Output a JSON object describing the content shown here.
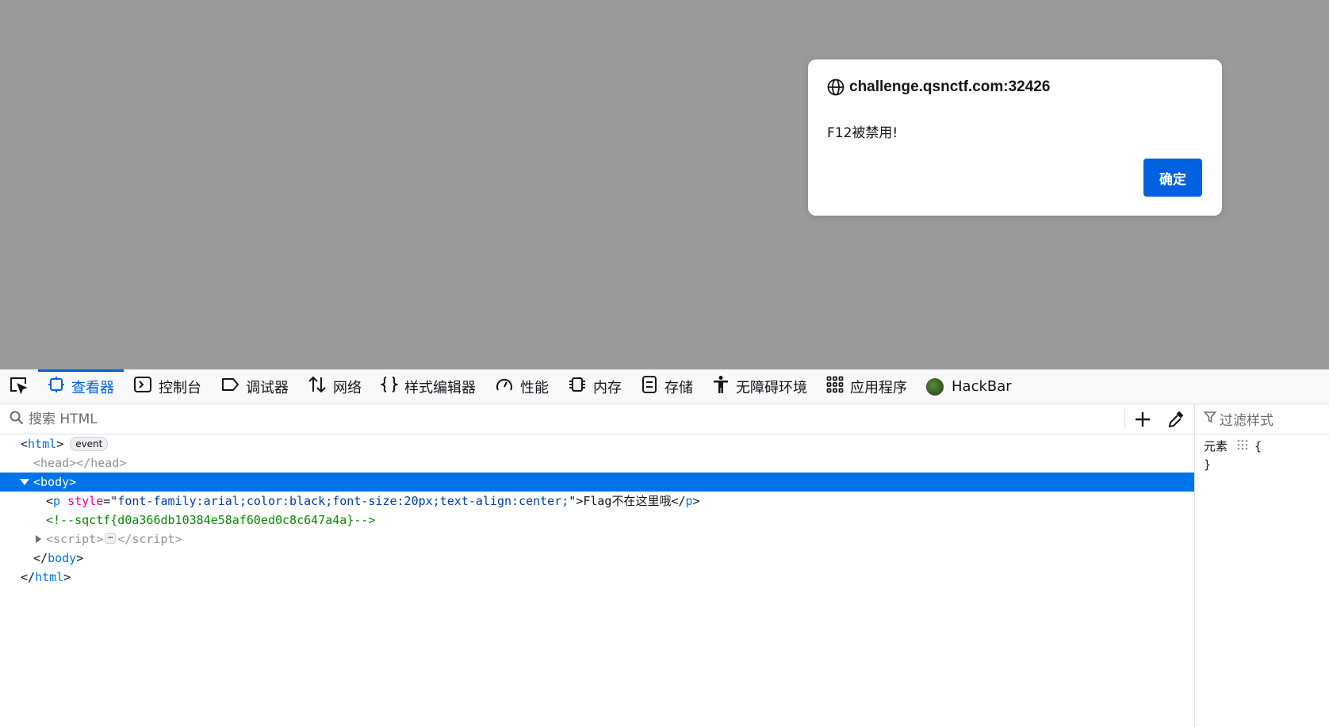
{
  "alert": {
    "origin": "challenge.qsnctf.com:32426",
    "message": "F12被禁用!",
    "ok_label": "确定"
  },
  "devtools": {
    "tabs": [
      {
        "label": "查看器",
        "icon": "inspector-icon",
        "selected": true
      },
      {
        "label": "控制台",
        "icon": "console-icon"
      },
      {
        "label": "调试器",
        "icon": "debugger-icon"
      },
      {
        "label": "网络",
        "icon": "network-icon"
      },
      {
        "label": "样式编辑器",
        "icon": "style-editor-icon"
      },
      {
        "label": "性能",
        "icon": "performance-icon"
      },
      {
        "label": "内存",
        "icon": "memory-icon"
      },
      {
        "label": "存储",
        "icon": "storage-icon"
      },
      {
        "label": "无障碍环境",
        "icon": "accessibility-icon"
      },
      {
        "label": "应用程序",
        "icon": "application-icon"
      },
      {
        "label": "HackBar",
        "icon": "hackbar-icon"
      }
    ],
    "search": {
      "placeholder": "搜索 HTML"
    },
    "tree": {
      "html_open": "html",
      "event_badge": "event",
      "head": "head",
      "body": "body",
      "p_tag": "p",
      "p_attr_name": "style",
      "p_attr_value": "font-family:arial;color:black;font-size:20px;text-align:center;",
      "p_text": "Flag不在这里哦",
      "comment": "<!--sqctf{d0a366db10384e58af60ed0c8c647a4a}-->",
      "script": "script",
      "ellipsis": "⋯"
    },
    "rules": {
      "filter_placeholder": "过滤样式",
      "element_label": "元素",
      "open_brace": "{",
      "close_brace": "}"
    }
  },
  "colors": {
    "accent": "#0061e0",
    "selection": "#0074e8",
    "page_overlay": "#9a9a9c",
    "comment": "#058b00",
    "attr_name": "#dd00a9",
    "attr_value": "#003eaa"
  }
}
